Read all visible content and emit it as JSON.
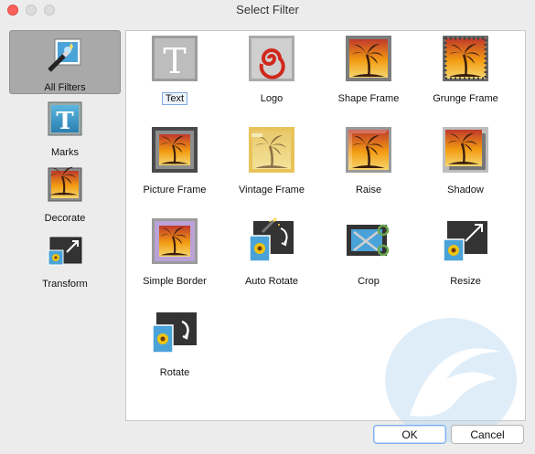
{
  "window": {
    "title": "Select Filter"
  },
  "sidebar": {
    "items": [
      {
        "label": "All Filters",
        "icon": "wand-icon"
      },
      {
        "label": "Marks",
        "icon": "text-t-icon"
      },
      {
        "label": "Decorate",
        "icon": "palm-frame-icon"
      },
      {
        "label": "Transform",
        "icon": "resize-icon"
      }
    ],
    "selected": "All Filters"
  },
  "filters": [
    {
      "label": "Text",
      "icon": "text-t-icon"
    },
    {
      "label": "Logo",
      "icon": "spiral-logo-icon"
    },
    {
      "label": "Shape Frame",
      "icon": "palm-frame-icon"
    },
    {
      "label": "Grunge Frame",
      "icon": "grunge-frame-icon"
    },
    {
      "label": "Picture Frame",
      "icon": "picture-frame-icon"
    },
    {
      "label": "Vintage Frame",
      "icon": "vintage-frame-icon"
    },
    {
      "label": "Raise",
      "icon": "raise-icon"
    },
    {
      "label": "Shadow",
      "icon": "shadow-icon"
    },
    {
      "label": "Simple Border",
      "icon": "simple-border-icon"
    },
    {
      "label": "Auto Rotate",
      "icon": "auto-rotate-icon"
    },
    {
      "label": "Crop",
      "icon": "crop-icon"
    },
    {
      "label": "Resize",
      "icon": "resize-icon"
    },
    {
      "label": "Rotate",
      "icon": "rotate-icon"
    }
  ],
  "selected_filter": "Text",
  "buttons": {
    "ok": "OK",
    "cancel": "Cancel"
  }
}
